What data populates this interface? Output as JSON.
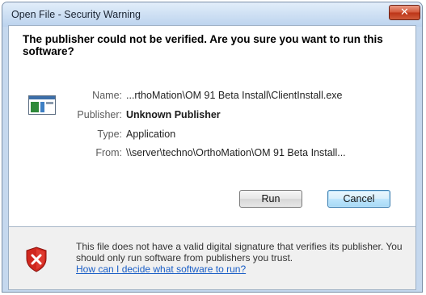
{
  "window": {
    "title": "Open File - Security Warning",
    "close_glyph": "✕"
  },
  "headline": "The publisher could not be verified.  Are you sure you want to run this software?",
  "fields": {
    "name_label": "Name:",
    "name_value": "...rthoMation\\OM 91 Beta Install\\ClientInstall.exe",
    "publisher_label": "Publisher:",
    "publisher_value": "Unknown Publisher",
    "type_label": "Type:",
    "type_value": "Application",
    "from_label": "From:",
    "from_value": "\\\\server\\techno\\OrthoMation\\OM 91 Beta Install..."
  },
  "buttons": {
    "run_label": "Run",
    "cancel_label": "Cancel"
  },
  "warning": {
    "text": "This file does not have a valid digital signature that verifies its publisher.  You should only run software from publishers you trust.",
    "link": "How can I decide what software to run?"
  },
  "icons": {
    "app": "application-icon",
    "shield": "security-shield-x-icon"
  },
  "colors": {
    "link": "#1a5ec6",
    "shield_red": "#c8231b",
    "close_red": "#c94a2c"
  }
}
